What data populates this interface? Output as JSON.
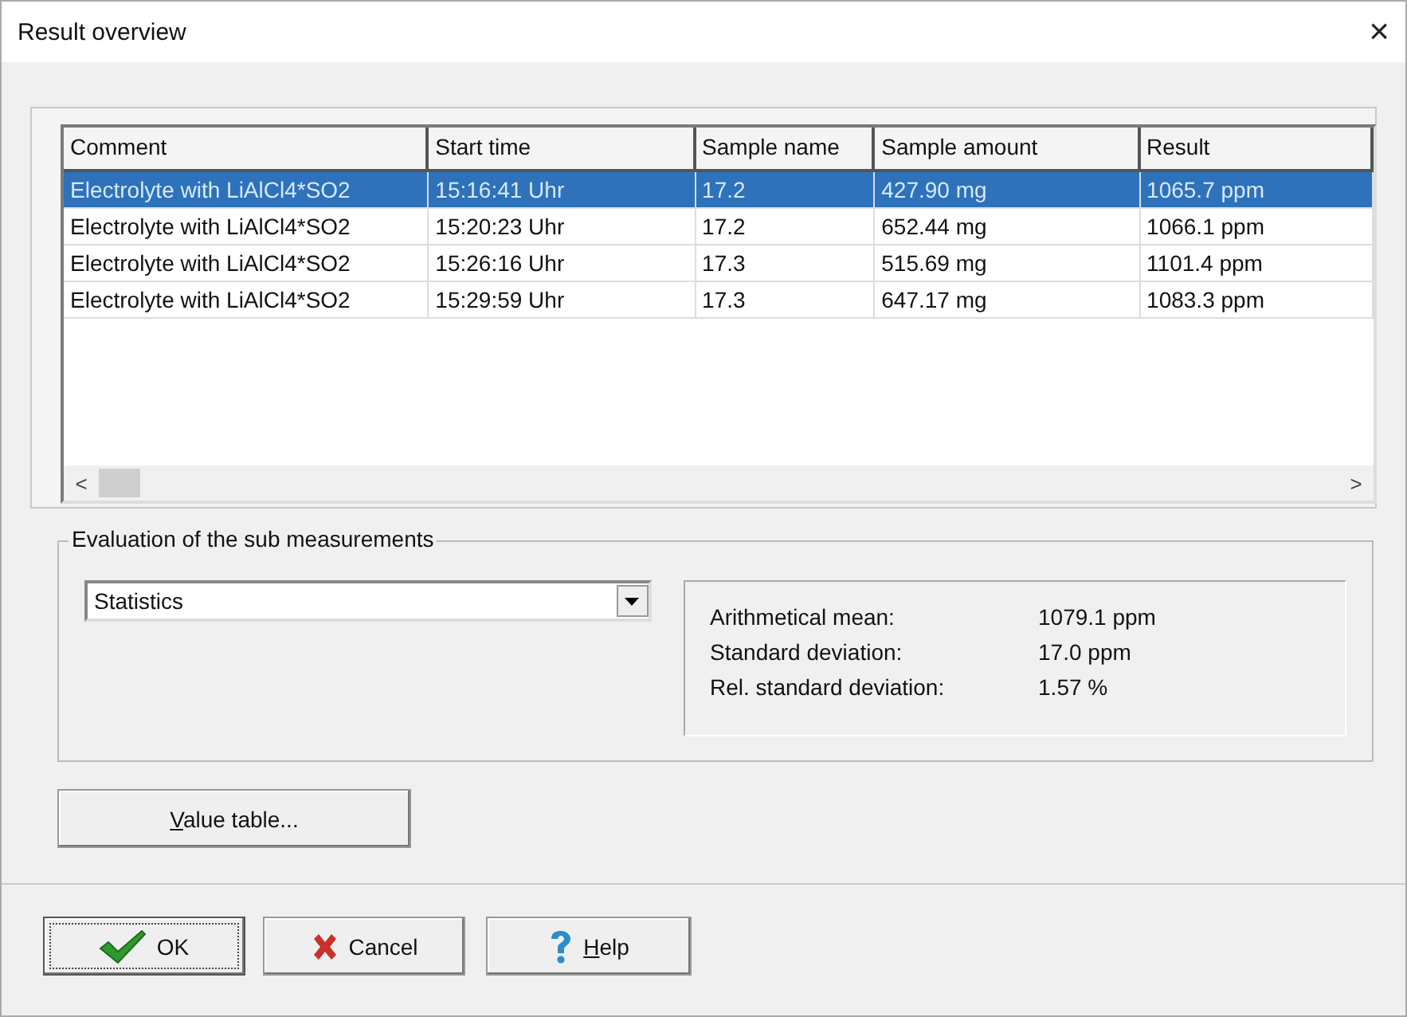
{
  "window": {
    "title": "Result overview",
    "close": "×"
  },
  "table": {
    "columns": [
      "Comment",
      "Start time",
      "Sample name",
      "Sample amount",
      "Result"
    ],
    "rows": [
      {
        "cells": [
          "Electrolyte with LiAlCl4*SO2",
          "15:16:41 Uhr",
          "17.2",
          "427.90 mg",
          "1065.7 ppm"
        ],
        "selected": true
      },
      {
        "cells": [
          "Electrolyte with LiAlCl4*SO2",
          "15:20:23 Uhr",
          "17.2",
          "652.44 mg",
          "1066.1 ppm"
        ],
        "selected": false
      },
      {
        "cells": [
          "Electrolyte with LiAlCl4*SO2",
          "15:26:16 Uhr",
          "17.3",
          "515.69 mg",
          "1101.4 ppm"
        ],
        "selected": false
      },
      {
        "cells": [
          "Electrolyte with LiAlCl4*SO2",
          "15:29:59 Uhr",
          "17.3",
          "647.17 mg",
          "1083.3 ppm"
        ],
        "selected": false
      }
    ],
    "scroll_left": "<",
    "scroll_right": ">"
  },
  "evaluation": {
    "title": "Evaluation of the sub measurements",
    "mode": "Statistics",
    "stats": [
      {
        "label": "Arithmetical mean:",
        "value": "1079.1 ppm"
      },
      {
        "label": "Standard deviation:",
        "value": "17.0 ppm"
      },
      {
        "label": "Rel. standard deviation:",
        "value": "1.57 %"
      }
    ]
  },
  "value_table_button": {
    "label": "Value table...",
    "mnemonic": true
  },
  "buttons": [
    {
      "kind": "ok",
      "label": "OK",
      "mnemonic": false,
      "focused": true
    },
    {
      "kind": "cancel",
      "label": "Cancel",
      "mnemonic": false,
      "focused": false
    },
    {
      "kind": "help",
      "label": "Help",
      "mnemonic": true,
      "focused": false
    }
  ]
}
